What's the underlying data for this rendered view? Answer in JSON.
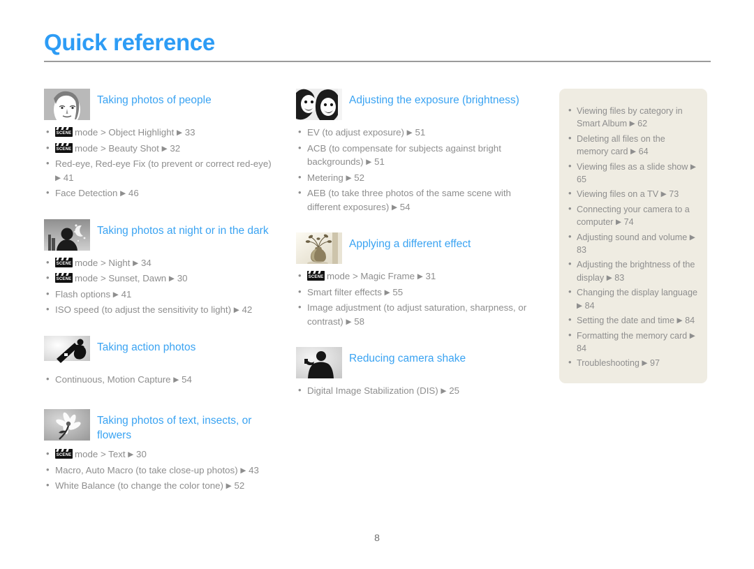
{
  "document": {
    "title": "Quick reference",
    "page_number": "8",
    "accent_color": "#3aa3f2",
    "title_color": "#2d9cf5",
    "body_color": "#8e8e8e",
    "sidebar_bg": "#efece2",
    "rule_color": "#9b9b9b",
    "arrow_glyph": "▶",
    "scene_badge_label": "SCENE"
  },
  "column_1": {
    "sections": [
      {
        "thumb_icon": "portrait-face-thumbnail",
        "title": "Taking photos of people",
        "items": [
          {
            "scene": true,
            "text": "mode > Object Highlight",
            "page": "33"
          },
          {
            "scene": true,
            "text": "mode > Beauty Shot",
            "page": "32"
          },
          {
            "scene": false,
            "text": "Red-eye, Red-eye Fix (to prevent or correct red-eye)",
            "page": "41"
          },
          {
            "scene": false,
            "text": "Face Detection",
            "page": "46"
          }
        ]
      },
      {
        "thumb_icon": "night-scene-thumbnail",
        "title": "Taking photos at night or in the dark",
        "items": [
          {
            "scene": true,
            "text": "mode > Night",
            "page": "34"
          },
          {
            "scene": true,
            "text": "mode > Sunset, Dawn",
            "page": "30"
          },
          {
            "scene": false,
            "text": "Flash options",
            "page": "41"
          },
          {
            "scene": false,
            "text": "ISO speed (to adjust the sensitivity to light)",
            "page": "42"
          }
        ]
      },
      {
        "thumb_icon": "snowboarder-action-thumbnail",
        "title": "Taking action photos",
        "items": [
          {
            "scene": false,
            "text": "Continuous, Motion Capture",
            "page": "54"
          }
        ]
      },
      {
        "thumb_icon": "flower-macro-thumbnail",
        "title": "Taking photos of text, insects, or flowers",
        "items": [
          {
            "scene": true,
            "text": "mode > Text",
            "page": "30"
          },
          {
            "scene": false,
            "text": "Macro, Auto Macro (to take close-up photos)",
            "page": "43"
          },
          {
            "scene": false,
            "text": "White Balance (to change the color tone)",
            "page": "52"
          }
        ]
      }
    ]
  },
  "column_2": {
    "sections": [
      {
        "thumb_icon": "two-faces-exposure-thumbnail",
        "title": "Adjusting the exposure (brightness)",
        "items": [
          {
            "scene": false,
            "text": "EV (to adjust exposure)",
            "page": "51"
          },
          {
            "scene": false,
            "text": "ACB (to compensate for subjects against bright backgrounds)",
            "page": "51"
          },
          {
            "scene": false,
            "text": "Metering",
            "page": "52"
          },
          {
            "scene": false,
            "text": "AEB (to take three photos of the same scene with different exposures)",
            "page": "54"
          }
        ]
      },
      {
        "thumb_icon": "vase-effect-thumbnail",
        "title": "Applying a different effect",
        "items": [
          {
            "scene": true,
            "text": "mode > Magic Frame",
            "page": "31"
          },
          {
            "scene": false,
            "text": "Smart filter effects",
            "page": "55"
          },
          {
            "scene": false,
            "text": "Image adjustment (to adjust saturation, sharpness, or contrast)",
            "page": "58"
          }
        ]
      },
      {
        "thumb_icon": "camera-shake-thumbnail",
        "title": "Reducing camera shake",
        "items": [
          {
            "scene": false,
            "text": "Digital Image Stabilization (DIS)",
            "page": "25"
          }
        ]
      }
    ]
  },
  "column_3": {
    "items": [
      {
        "text": "Viewing files by category in Smart Album",
        "page": "62"
      },
      {
        "text": "Deleting all files on the memory card",
        "page": "64"
      },
      {
        "text": "Viewing files as a slide show",
        "page": "65"
      },
      {
        "text": "Viewing files on a TV",
        "page": "73"
      },
      {
        "text": "Connecting your camera to a computer",
        "page": "74"
      },
      {
        "text": "Adjusting sound and volume",
        "page": "83"
      },
      {
        "text": "Adjusting the brightness of the display",
        "page": "83"
      },
      {
        "text": "Changing the display language",
        "page": "84"
      },
      {
        "text": "Setting the date and time",
        "page": "84"
      },
      {
        "text": "Formatting the memory card",
        "page": "84"
      },
      {
        "text": "Troubleshooting",
        "page": "97"
      }
    ]
  }
}
